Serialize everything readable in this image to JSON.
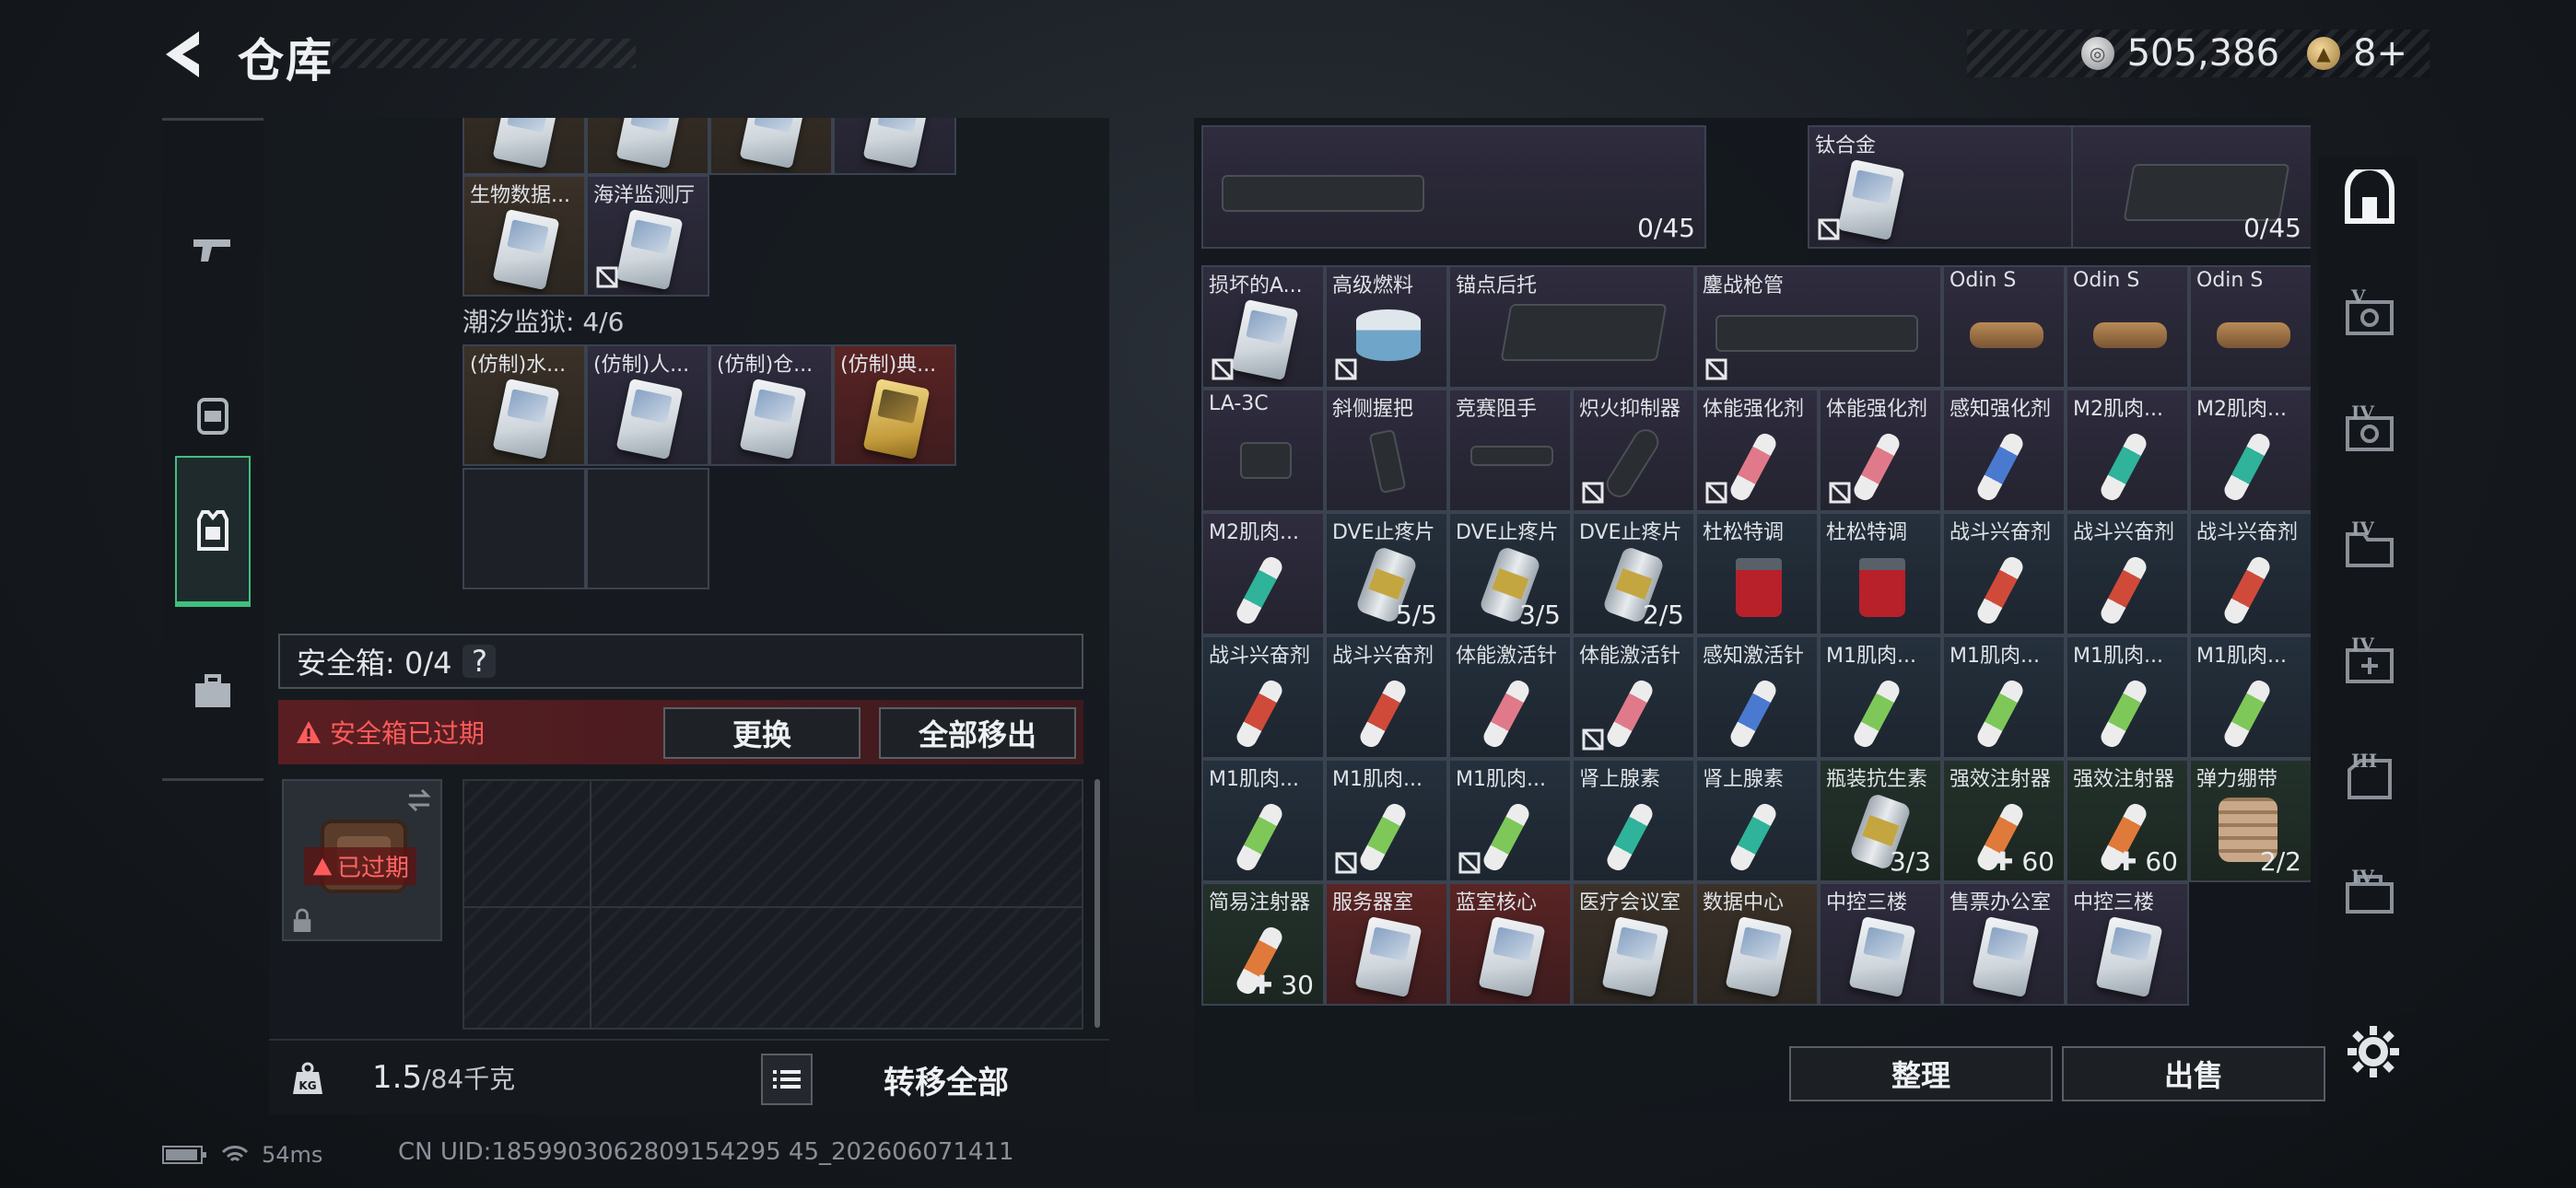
{
  "header": {
    "title": "仓库"
  },
  "currency": {
    "coins": "505,386",
    "premium": "8+"
  },
  "left_rail": [
    "pistol-icon",
    "backpack-icon",
    "vest-icon",
    "toolbox-icon"
  ],
  "left": {
    "cards_row2": [
      {
        "label": "生物数据...",
        "color": "brown"
      },
      {
        "label": "海洋监测厅",
        "color": "purple",
        "locked": true
      }
    ],
    "prison_section": "潮汐监狱: 4/6",
    "prison_cards": [
      {
        "label": "(仿制)水...",
        "color": "brown"
      },
      {
        "label": "(仿制)人...",
        "color": "purple"
      },
      {
        "label": "(仿制)仓...",
        "color": "purple"
      },
      {
        "label": "(仿制)典...",
        "color": "red"
      }
    ],
    "safe_box": {
      "label": "安全箱: 0/4",
      "help": "?"
    },
    "expired_message": "安全箱已过期",
    "replace_button": "更换",
    "move_all_out_button": "全部移出",
    "expired_badge": "已过期",
    "weight": {
      "current": "1.5",
      "max": "/84千克"
    },
    "transfer_all_button": "转移全部"
  },
  "right": {
    "top_row": [
      {
        "label": "",
        "count": "0/45"
      },
      {
        "label": "钛合金",
        "count": ""
      },
      {
        "label": "",
        "count": "0/45"
      }
    ],
    "rows": [
      [
        {
          "label": "损坏的A...",
          "color": "purple",
          "art": "keycard",
          "locked": true
        },
        {
          "label": "高级燃料",
          "color": "purple",
          "art": "fuel",
          "locked": true
        },
        {
          "label": "锚点后托",
          "color": "purple",
          "art": "stock",
          "span": 2
        },
        {
          "label": "鏖战枪管",
          "color": "purple",
          "art": "barrel",
          "span": 2,
          "locked": true
        },
        {
          "label": "Odin S",
          "color": "purple",
          "art": "scope"
        },
        {
          "label": "Odin S",
          "color": "purple",
          "art": "scope"
        },
        {
          "label": "Odin S",
          "color": "purple",
          "art": "scope"
        }
      ],
      [
        {
          "label": "LA-3C",
          "color": "purple",
          "art": "device"
        },
        {
          "label": "斜侧握把",
          "color": "purple",
          "art": "grip"
        },
        {
          "label": "竞赛阻手",
          "color": "purple",
          "art": "rail"
        },
        {
          "label": "炽火抑制器",
          "color": "purple",
          "art": "suppressor",
          "locked": true
        },
        {
          "label": "体能强化剂",
          "color": "purple",
          "art": "vial-pink",
          "locked": true
        },
        {
          "label": "体能强化剂",
          "color": "purple",
          "art": "vial-pink",
          "locked": true
        },
        {
          "label": "感知强化剂",
          "color": "purple",
          "art": "vial-blue"
        },
        {
          "label": "M2肌肉...",
          "color": "purple",
          "art": "vial-teal"
        },
        {
          "label": "M2肌肉...",
          "color": "purple",
          "art": "vial-teal"
        }
      ],
      [
        {
          "label": "M2肌肉...",
          "color": "purple",
          "art": "vial-teal"
        },
        {
          "label": "DVE止疼片",
          "color": "blue",
          "art": "bottle",
          "count": "5/5"
        },
        {
          "label": "DVE止疼片",
          "color": "blue",
          "art": "bottle",
          "count": "3/5"
        },
        {
          "label": "DVE止疼片",
          "color": "blue",
          "art": "bottle",
          "count": "2/5"
        },
        {
          "label": "杜松特调",
          "color": "blue",
          "art": "drink"
        },
        {
          "label": "杜松特调",
          "color": "blue",
          "art": "drink"
        },
        {
          "label": "战斗兴奋剂",
          "color": "blue",
          "art": "vial-red"
        },
        {
          "label": "战斗兴奋剂",
          "color": "blue",
          "art": "vial-red"
        },
        {
          "label": "战斗兴奋剂",
          "color": "blue",
          "art": "vial-red"
        }
      ],
      [
        {
          "label": "战斗兴奋剂",
          "color": "blue",
          "art": "vial-red"
        },
        {
          "label": "战斗兴奋剂",
          "color": "blue",
          "art": "vial-red"
        },
        {
          "label": "体能激活针",
          "color": "blue",
          "art": "vial-pink"
        },
        {
          "label": "体能激活针",
          "color": "blue",
          "art": "vial-pink",
          "locked": true
        },
        {
          "label": "感知激活针",
          "color": "blue",
          "art": "vial-blue"
        },
        {
          "label": "M1肌肉...",
          "color": "blue",
          "art": "vial-lime"
        },
        {
          "label": "M1肌肉...",
          "color": "blue",
          "art": "vial-lime"
        },
        {
          "label": "M1肌肉...",
          "color": "blue",
          "art": "vial-lime"
        },
        {
          "label": "M1肌肉...",
          "color": "blue",
          "art": "vial-lime"
        }
      ],
      [
        {
          "label": "M1肌肉...",
          "color": "blue",
          "art": "vial-lime"
        },
        {
          "label": "M1肌肉...",
          "color": "blue",
          "art": "vial-lime",
          "locked": true
        },
        {
          "label": "M1肌肉...",
          "color": "blue",
          "art": "vial-lime",
          "locked": true
        },
        {
          "label": "肾上腺素",
          "color": "blue",
          "art": "vial-teal"
        },
        {
          "label": "肾上腺素",
          "color": "blue",
          "art": "vial-teal"
        },
        {
          "label": "瓶装抗生素",
          "color": "green",
          "art": "bottle",
          "count": "3/3"
        },
        {
          "label": "强效注射器",
          "color": "green",
          "art": "vial-orange",
          "plus": "60"
        },
        {
          "label": "强效注射器",
          "color": "green",
          "art": "vial-orange",
          "plus": "60"
        },
        {
          "label": "弹力绷带",
          "color": "green",
          "art": "bandage",
          "count": "2/2"
        }
      ],
      [
        {
          "label": "简易注射器",
          "color": "green",
          "art": "vial-orange",
          "plus": "30"
        },
        {
          "label": "服务器室",
          "color": "red",
          "art": "keycard"
        },
        {
          "label": "蓝室核心",
          "color": "red",
          "art": "keycard"
        },
        {
          "label": "医疗会议室",
          "color": "brown",
          "art": "keycard"
        },
        {
          "label": "数据中心",
          "color": "brown",
          "art": "keycard"
        },
        {
          "label": "中控三楼",
          "color": "purple",
          "art": "keycard"
        },
        {
          "label": "售票办公室",
          "color": "purple",
          "art": "keycard"
        },
        {
          "label": "中控三楼",
          "color": "purple",
          "art": "keycard"
        }
      ]
    ],
    "sort_button": "整理",
    "sell_button": "出售"
  },
  "right_rail": [
    {
      "icon": "vault-icon",
      "tier": ""
    },
    {
      "icon": "safe-v-icon",
      "tier": "V"
    },
    {
      "icon": "safe-iv-icon",
      "tier": "IV"
    },
    {
      "icon": "folder-iv-icon",
      "tier": "IV"
    },
    {
      "icon": "medkit-iv-icon",
      "tier": "IV"
    },
    {
      "icon": "case-iii-icon",
      "tier": "III"
    },
    {
      "icon": "case-iv-icon",
      "tier": "IV"
    }
  ],
  "status": {
    "ping": "54ms",
    "uid": "CN UID:1859903062809154295 45_202606071411"
  }
}
